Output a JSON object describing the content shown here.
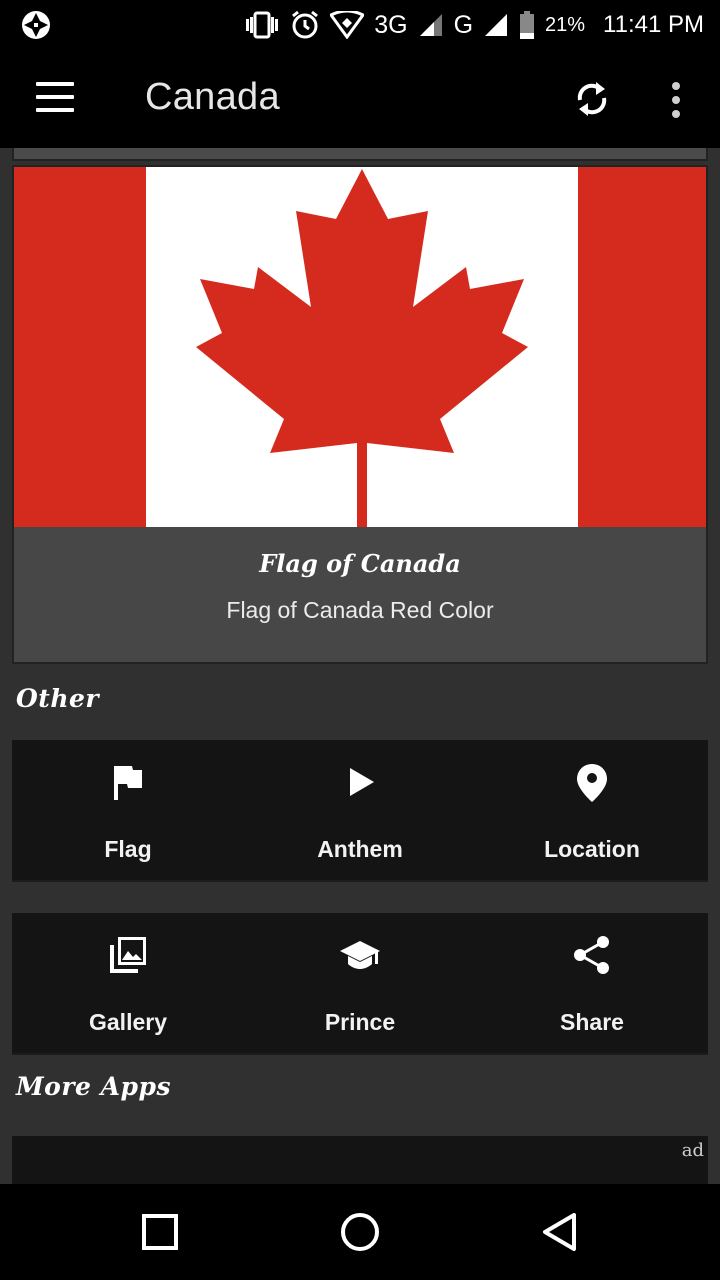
{
  "status_bar": {
    "network_1": "3G",
    "network_2": "G",
    "battery": "21%",
    "time": "11:41 PM"
  },
  "app_bar": {
    "title": "Canada"
  },
  "flag_card": {
    "title": "Flag of Canada",
    "subtitle": "Flag of Canada Red Color",
    "flag_red": "#d52b1e",
    "flag_white": "#ffffff"
  },
  "sections": {
    "other": "Other",
    "more_apps": "More Apps"
  },
  "buttons_row1": [
    {
      "label": "Flag",
      "icon": "flag-icon"
    },
    {
      "label": "Anthem",
      "icon": "play-icon"
    },
    {
      "label": "Location",
      "icon": "location-pin-icon"
    }
  ],
  "buttons_row2": [
    {
      "label": "Gallery",
      "icon": "gallery-icon"
    },
    {
      "label": "Prince",
      "icon": "graduation-cap-icon"
    },
    {
      "label": "Share",
      "icon": "share-icon"
    }
  ],
  "ad": {
    "label": "ad"
  },
  "colors": {
    "background": "#303030",
    "bar": "#000000",
    "tile": "#141414",
    "card": "#474747"
  }
}
